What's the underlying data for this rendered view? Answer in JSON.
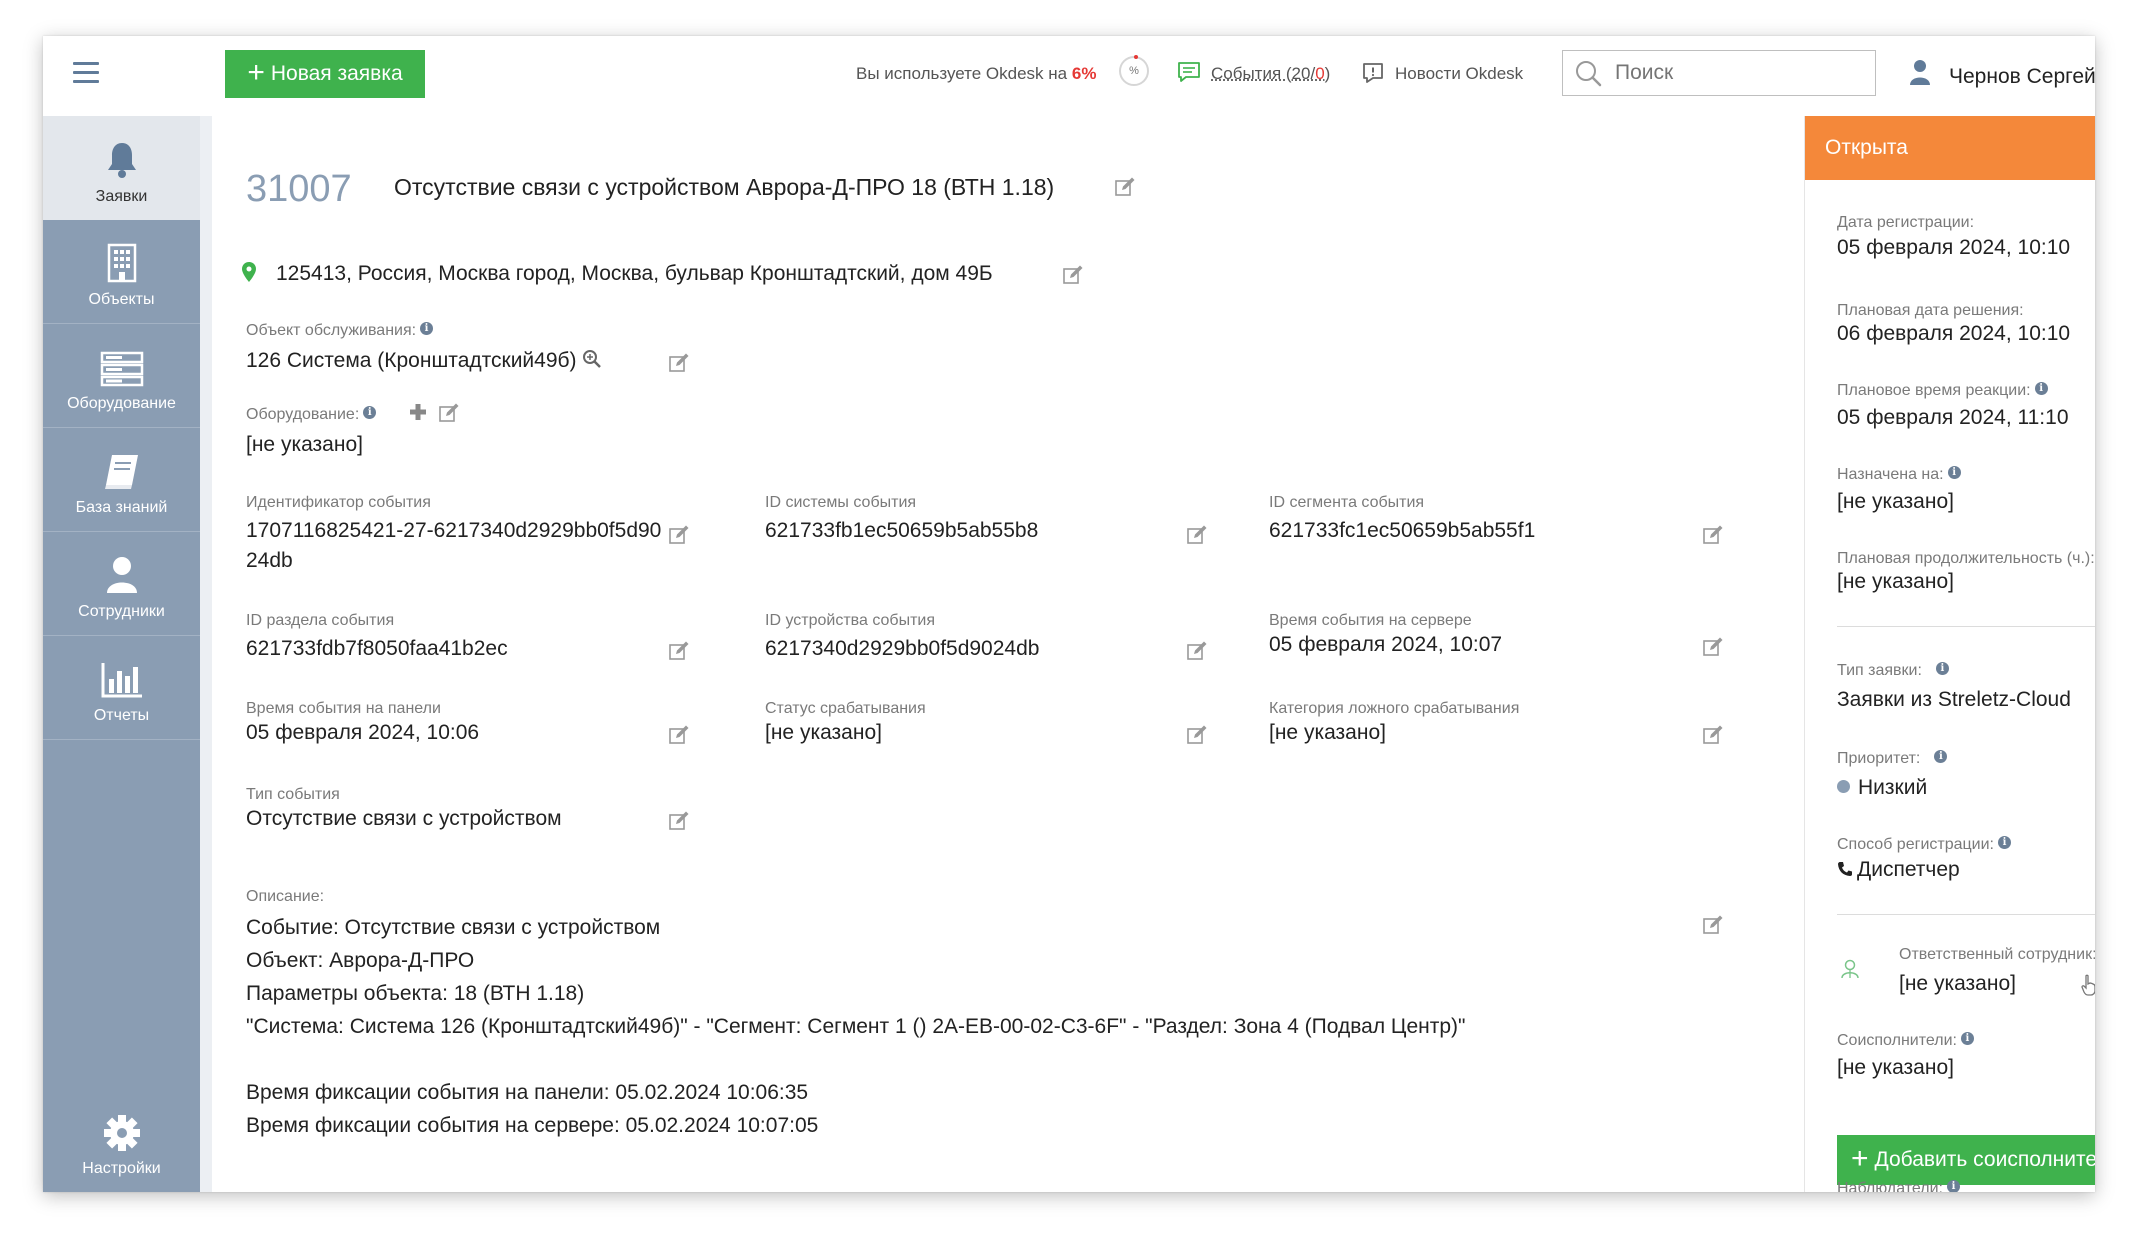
{
  "topbar": {
    "new_ticket_label": "Новая заявка",
    "usage_prefix": "Вы используете Okdesk на",
    "usage_percent": "6%",
    "usage_ring_symbol": "%",
    "events_prefix": "События (20/",
    "events_count": "0",
    "events_suffix": ")",
    "news_label": "Новости Okdesk",
    "search_placeholder": "Поиск",
    "user_name": "Чернов Сергей"
  },
  "sidebar": {
    "items": [
      {
        "label": "Заявки",
        "icon": "bell-icon"
      },
      {
        "label": "Объекты",
        "icon": "building-icon"
      },
      {
        "label": "Оборудование",
        "icon": "server-icon"
      },
      {
        "label": "База знаний",
        "icon": "book-icon"
      },
      {
        "label": "Сотрудники",
        "icon": "person-icon"
      },
      {
        "label": "Отчеты",
        "icon": "bar-chart-icon"
      }
    ],
    "settings_label": "Настройки"
  },
  "ticket": {
    "number": "31007",
    "title": "Отсутствие связи с устройством Аврора-Д-ПРО 18 (ВТН 1.18)",
    "address": "125413, Россия, Москва город, Москва, бульвар Кронштадтский, дом 49Б",
    "service_object_label": "Объект обслуживания:",
    "service_object_value": "126 Система (Кронштадтский49б)",
    "equipment_label": "Оборудование:",
    "equipment_value": "[не указано]",
    "fields": {
      "event_id_label": "Идентификатор события",
      "event_id_line1": "1707116825421-27-6217340d2929bb0f5d90",
      "event_id_line2": "24db",
      "system_id_label": "ID системы события",
      "system_id_value": "621733fb1ec50659b5ab55b8",
      "segment_id_label": "ID сегмента события",
      "segment_id_value": "621733fc1ec50659b5ab55f1",
      "section_id_label": "ID раздела события",
      "section_id_value": "621733fdb7f8050faa41b2ec",
      "device_id_label": "ID устройства события",
      "device_id_value": "6217340d2929bb0f5d9024db",
      "server_time_label": "Время события на сервере",
      "server_time_value": "05 февраля 2024, 10:07",
      "panel_time_label": "Время события на панели",
      "panel_time_value": "05 февраля 2024, 10:06",
      "trigger_status_label": "Статус срабатывания",
      "trigger_status_value": "[не указано]",
      "false_category_label": "Категория ложного срабатывания",
      "false_category_value": "[не указано]",
      "event_type_label": "Тип события",
      "event_type_value": "Отсутствие связи с устройством"
    },
    "description_label": "Описание:",
    "description_lines": [
      "Событие: Отсутствие связи с устройством",
      "Объект: Аврора-Д-ПРО",
      "Параметры объекта: 18 (ВТН 1.18)",
      "\"Система: Система 126 (Кронштадтский49б)\" - \"Сегмент: Сегмент 1 () 2A-EB-00-02-C3-6F\" - \"Раздел: Зона 4 (Подвал Центр)\"",
      "",
      "Время фиксации события на панели: 05.02.2024 10:06:35",
      "Время фиксации события на сервере: 05.02.2024 10:07:05"
    ]
  },
  "right_panel": {
    "status": "Открыта",
    "status_color": "#f4883a",
    "reg_date_label": "Дата регистрации:",
    "reg_date_value": "05 февраля 2024, 10:10",
    "plan_solve_label": "Плановая дата решения:",
    "plan_solve_value": "06 февраля 2024, 10:10",
    "plan_react_label": "Плановое время реакции:",
    "plan_react_value": "05 февраля 2024, 11:10",
    "assigned_label": "Назначена на:",
    "assigned_value": "[не указано]",
    "duration_label": "Плановая продолжительность (ч.):",
    "duration_value": "[не указано]",
    "type_label": "Тип заявки:",
    "type_value": "Заявки из Streletz-Cloud",
    "priority_label": "Приоритет:",
    "priority_value": "Низкий",
    "reg_method_label": "Способ регистрации:",
    "reg_method_value": "Диспетчер",
    "responsible_label": "Ответственный сотрудник:",
    "responsible_value": "[не указано]",
    "coexec_label": "Соисполнители:",
    "coexec_value": "[не указано]",
    "add_coexec_label": "Добавить соисполнителя",
    "observers_label": "Наблюдатели:"
  },
  "colors": {
    "accent_green": "#3fb24d",
    "sidebar": "#8a9db3",
    "status_orange": "#f4883a",
    "danger_red": "#e53935"
  }
}
